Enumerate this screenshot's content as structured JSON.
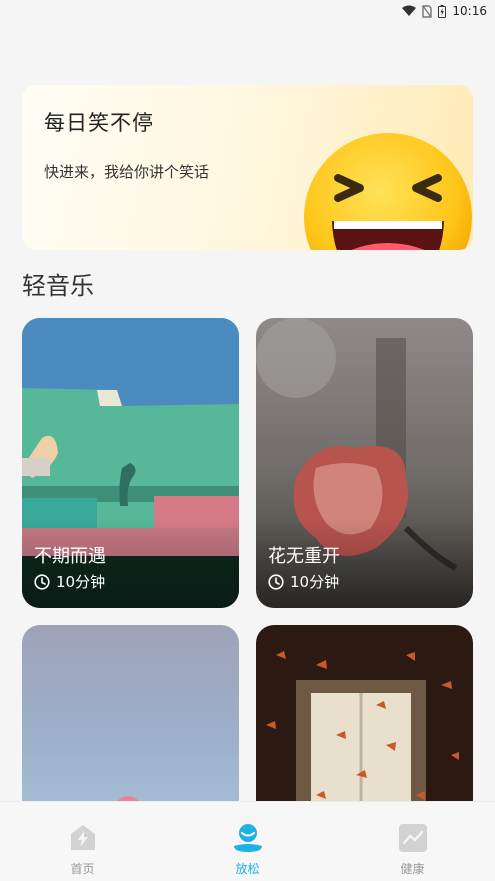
{
  "status_bar": {
    "time": "10:16"
  },
  "banner": {
    "title": "每日笑不停",
    "subtitle": "快进来，我给你讲个笑话"
  },
  "section": {
    "title": "轻音乐"
  },
  "cards": [
    {
      "title": "不期而遇",
      "duration": "10分钟"
    },
    {
      "title": "花无重开",
      "duration": "10分钟"
    },
    {
      "title": "",
      "duration": ""
    },
    {
      "title": "",
      "duration": ""
    }
  ],
  "nav": {
    "items": [
      {
        "label": "首页",
        "icon": "lightning-home-icon"
      },
      {
        "label": "放松",
        "icon": "relax-person-icon"
      },
      {
        "label": "健康",
        "icon": "health-chart-icon"
      }
    ],
    "active_color": "#1db1e6"
  }
}
